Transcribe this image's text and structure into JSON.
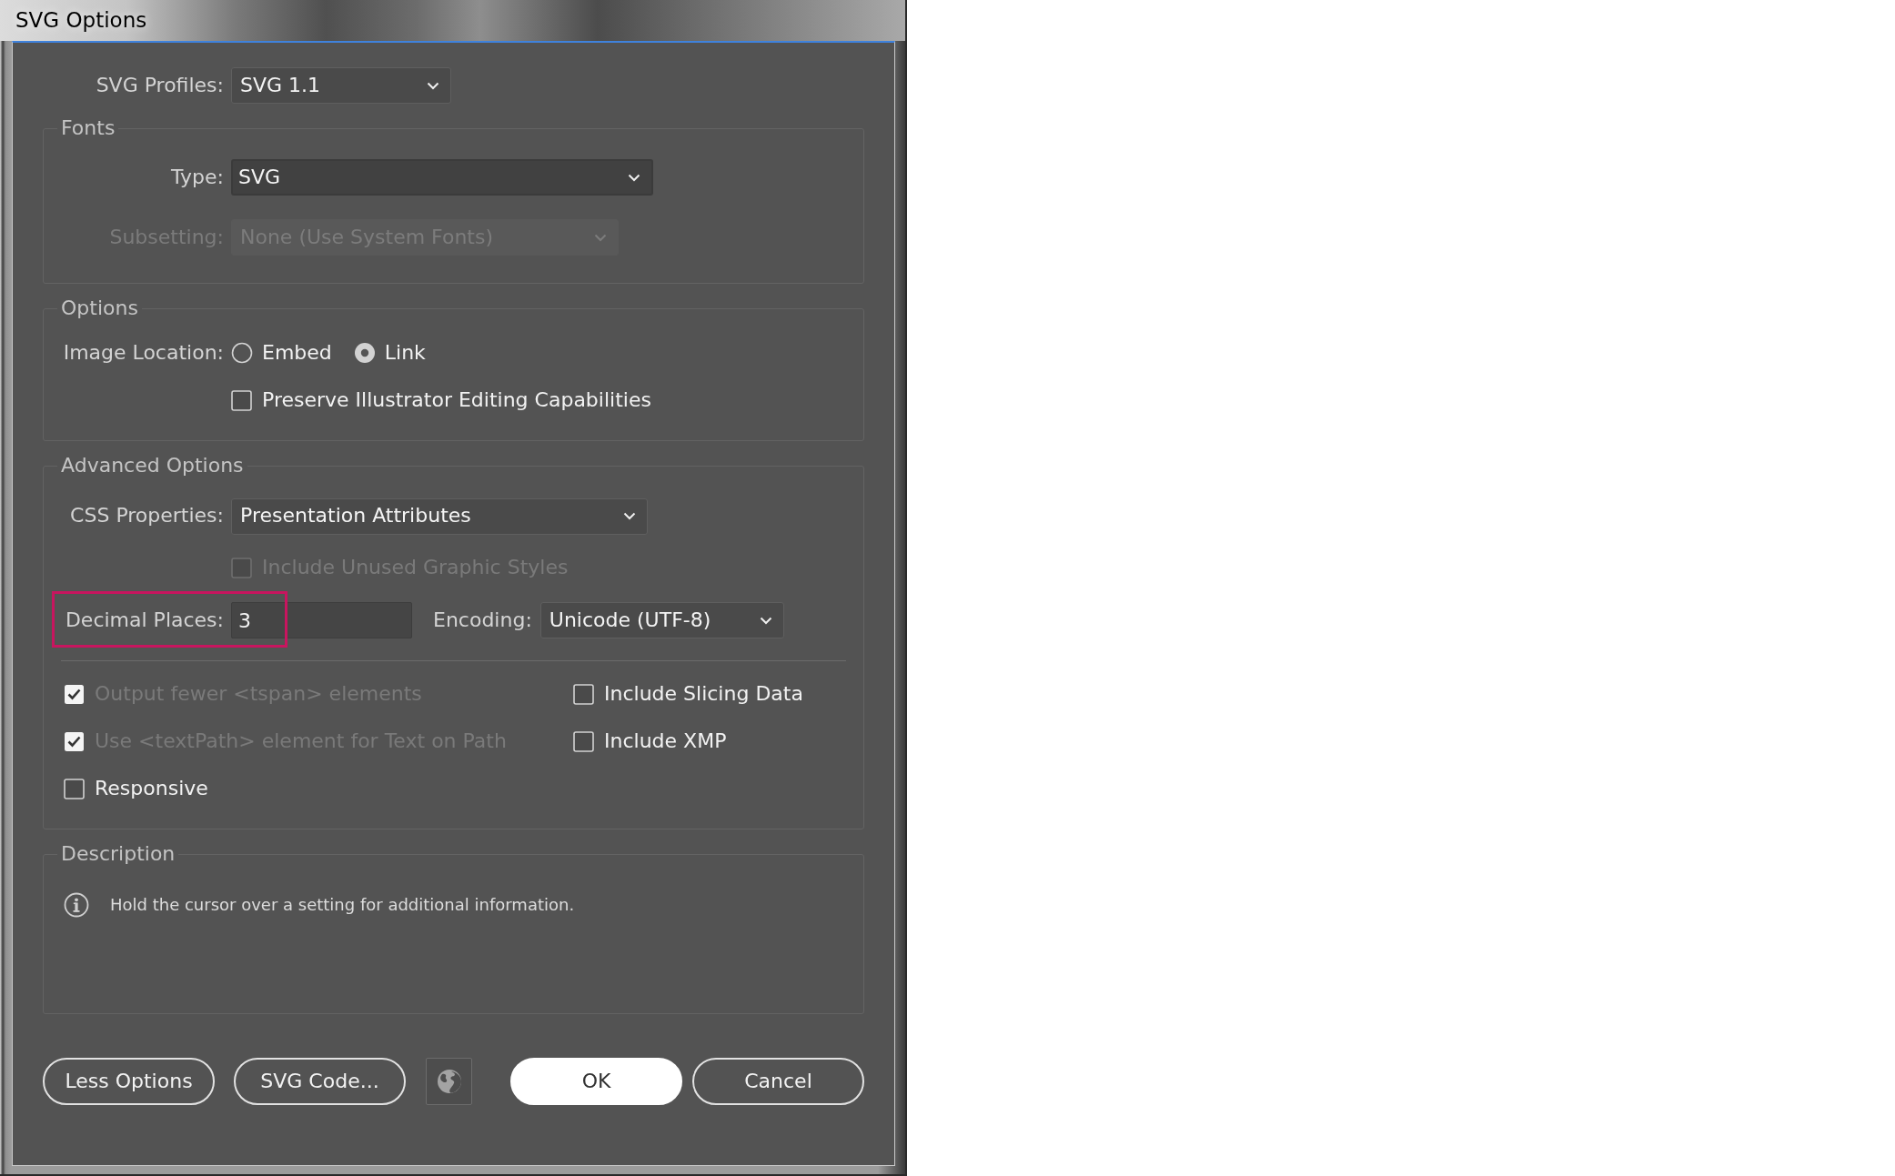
{
  "window": {
    "title": "SVG Options"
  },
  "svg_profiles": {
    "label": "SVG Profiles:",
    "value": "SVG 1.1"
  },
  "fonts": {
    "legend": "Fonts",
    "type": {
      "label": "Type:",
      "value": "SVG",
      "focused": true
    },
    "subsetting": {
      "label": "Subsetting:",
      "value": "None (Use System Fonts)",
      "disabled": true
    }
  },
  "options": {
    "legend": "Options",
    "image_location": {
      "label": "Image Location:",
      "choices": [
        {
          "label": "Embed",
          "selected": false
        },
        {
          "label": "Link",
          "selected": true
        }
      ]
    },
    "preserve_editing": {
      "label": "Preserve Illustrator Editing Capabilities",
      "checked": false
    }
  },
  "advanced_options": {
    "legend": "Advanced Options",
    "css_properties": {
      "label": "CSS Properties:",
      "value": "Presentation Attributes"
    },
    "include_unused_styles": {
      "label": "Include Unused Graphic Styles",
      "checked": false,
      "disabled": true
    },
    "decimal_places": {
      "label": "Decimal Places:",
      "value": "3",
      "highlighted": true
    },
    "encoding": {
      "label": "Encoding:",
      "value": "Unicode (UTF-8)"
    },
    "checkbox_columns": [
      [
        {
          "label": "Output fewer <tspan> elements",
          "checked": true,
          "disabled": true
        },
        {
          "label": "Use <textPath> element for Text on Path",
          "checked": true,
          "disabled": true
        },
        {
          "label": "Responsive",
          "checked": false,
          "disabled": false
        }
      ],
      [
        {
          "label": "Include Slicing Data",
          "checked": false,
          "disabled": false
        },
        {
          "label": "Include XMP",
          "checked": false,
          "disabled": false
        }
      ]
    ]
  },
  "description": {
    "legend": "Description",
    "text": "Hold the cursor over a setting for additional information."
  },
  "buttons": [
    {
      "kind": "outline",
      "label": "Less Options"
    },
    {
      "kind": "outline",
      "label": "SVG Code..."
    },
    {
      "kind": "icon"
    },
    {
      "kind": "primary",
      "label": "OK"
    },
    {
      "kind": "outline",
      "label": "Cancel"
    }
  ]
}
